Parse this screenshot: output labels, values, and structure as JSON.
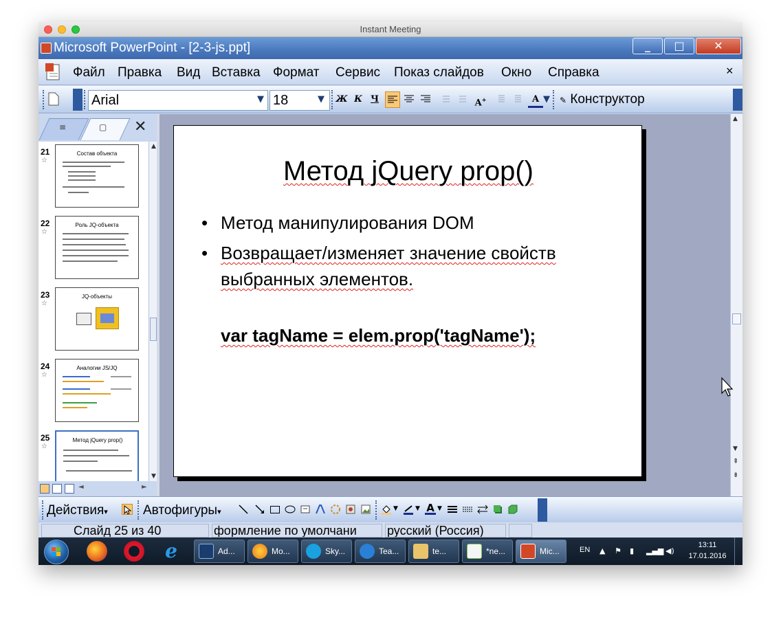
{
  "mac_window": {
    "title": "Instant Meeting"
  },
  "ppt_window": {
    "title": "Microsoft PowerPoint - [2-3-js.ppt]",
    "min_label": "_",
    "max_label": "□",
    "close_label": "✕"
  },
  "menu": {
    "items": [
      "Файл",
      "Правка",
      "Вид",
      "Вставка",
      "Формат",
      "Сервис",
      "Показ слайдов",
      "Окно",
      "Справка"
    ],
    "close_label": "×"
  },
  "toolbar": {
    "font_name": "Arial",
    "font_size": "18",
    "bold": "Ж",
    "italic": "К",
    "underline": "Ч",
    "constructor_label": "Конструктор"
  },
  "left_pane": {
    "close_label": "✕",
    "thumbnails": [
      {
        "number": "21",
        "title": "Состав объекта",
        "selected": false
      },
      {
        "number": "22",
        "title": "Роль JQ-объекта",
        "selected": false
      },
      {
        "number": "23",
        "title": "JQ-объекты",
        "selected": false
      },
      {
        "number": "24",
        "title": "Аналогии JS/JQ",
        "selected": false
      },
      {
        "number": "25",
        "title": "Метод jQuery prop()",
        "selected": true
      }
    ]
  },
  "slide": {
    "title": "Метод jQuery prop()",
    "bullets": [
      "Метод манипулирования DOM",
      "Возвращает/изменяет значение свойств выбранных элементов."
    ],
    "code": "var tagName = elem.prop('tagName');"
  },
  "draw_toolbar": {
    "actions_label": "Действия",
    "autoshapes_label": "Автофигуры"
  },
  "status": {
    "slide_info": "Слайд 25 из 40",
    "design": "формление по умолчани",
    "language": "русский (Россия)"
  },
  "taskbar": {
    "tasks": [
      {
        "label": "Ad...",
        "color": "#1b3d6e"
      },
      {
        "label": "Mo...",
        "color": "#e8741d"
      },
      {
        "label": "Sky...",
        "color": "#1aa1e0"
      },
      {
        "label": "Tea...",
        "color": "#2a7fd6"
      },
      {
        "label": "te...",
        "color": "#e9c46a"
      },
      {
        "label": "*ne...",
        "color": "#7cbf4a"
      },
      {
        "label": "Mic...",
        "color": "#d24726"
      }
    ],
    "language": "EN",
    "time": "13:11",
    "date": "17.01.2016"
  },
  "colors": {
    "title_bar": "#4a78bd",
    "slide_bg": "#ffffff",
    "workspace": "#a1a9c2",
    "accent_selected": "#f9c97a"
  }
}
